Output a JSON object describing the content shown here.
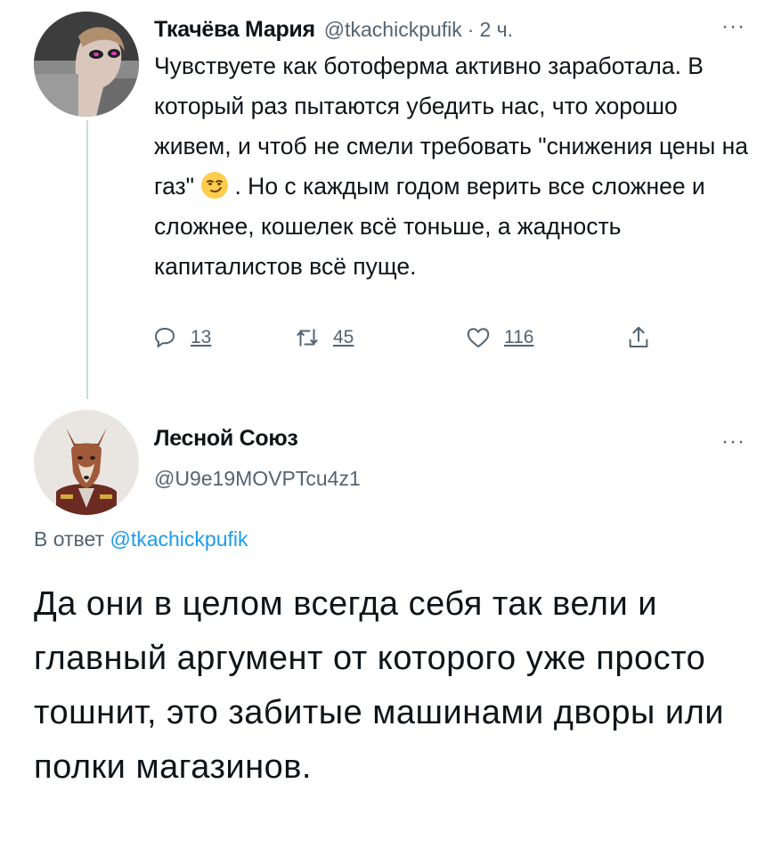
{
  "tweet1": {
    "name": "Ткачёва Мария",
    "handle": "@tkachickpufik",
    "dot": "·",
    "time": "2 ч.",
    "more": "···",
    "text_part1": "Чувствуете как ботоферма активно заработала. В который раз пытаются убедить нас, что хорошо живем, и чтоб не смели требовать \"снижения цены на газ\" ",
    "text_part2": ". Но с каждым годом верить все сложнее и сложнее, кошелек всё тоньше, а жадность капиталистов всё пуще.",
    "emoji": "smirking-face-emoji",
    "replies": "13",
    "retweets": "45",
    "likes": "116"
  },
  "tweet2": {
    "name": "Лесной Союз",
    "handle": "@U9e19MOVPTcu4z1",
    "more": "···",
    "replying_prefix": "В ответ ",
    "replying_to": "@tkachickpufik",
    "text": "Да они в целом всегда себя так вели и главный аргумент от которого уже просто тошнит, это забитые машинами дворы или полки магазинов."
  },
  "colors": {
    "text": "#0f1419",
    "secondary": "#536471",
    "link": "#1d9bf0",
    "thread_line": "#cfd9de"
  }
}
